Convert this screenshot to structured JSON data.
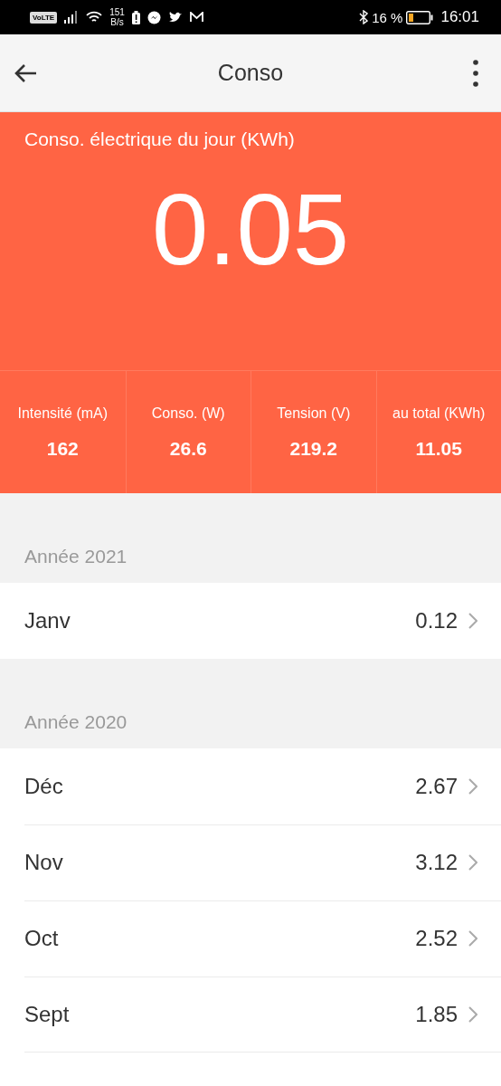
{
  "status_bar": {
    "volte": "VoLTE",
    "speed": "151",
    "speed_unit": "B/s",
    "battery": "16 %",
    "time": "16:01"
  },
  "app_bar": {
    "title": "Conso"
  },
  "today": {
    "label": "Conso. électrique du jour (KWh)",
    "value": "0.05"
  },
  "stats": [
    {
      "label": "Intensité (mA)",
      "value": "162"
    },
    {
      "label": "Conso. (W)",
      "value": "26.6"
    },
    {
      "label": "Tension (V)",
      "value": "219.2"
    },
    {
      "label": "au total (KWh)",
      "value": "11.05"
    }
  ],
  "sections": [
    {
      "title": "Année 2021",
      "months": [
        {
          "name": "Janv",
          "value": "0.12"
        }
      ]
    },
    {
      "title": "Année 2020",
      "months": [
        {
          "name": "Déc",
          "value": "2.67"
        },
        {
          "name": "Nov",
          "value": "3.12"
        },
        {
          "name": "Oct",
          "value": "2.52"
        },
        {
          "name": "Sept",
          "value": "1.85"
        }
      ]
    }
  ]
}
